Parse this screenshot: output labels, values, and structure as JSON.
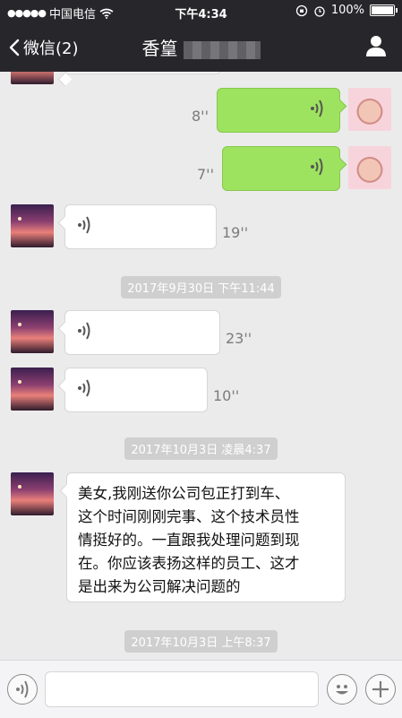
{
  "status_bar": {
    "carrier": "中国电信",
    "time": "下午4:34",
    "battery": "100%"
  },
  "nav": {
    "back_label": "微信(2)",
    "title": "香篁"
  },
  "messages": {
    "m1_duration": "8''",
    "m2_duration": "7''",
    "m3_duration": "19''",
    "m4_duration": "23''",
    "m5_duration": "10''",
    "text_message": "美女,我刚送你公司包正打到车、\n这个时间刚刚完事、这个技术员性\n情挺好的。一直跟我处理问题到现\n在。你应该表扬这样的员工、这才\n是出来为公司解决问题的"
  },
  "timestamps": {
    "t1": "2017年9月30日 下午11:44",
    "t2": "2017年10月3日 凌晨4:37",
    "t3": "2017年10月3日 上午8:37"
  },
  "icons": [
    "back-chevron-icon",
    "person-icon",
    "wifi-icon",
    "battery-icon",
    "voice-wave-icon",
    "emoji-icon",
    "plus-icon"
  ]
}
